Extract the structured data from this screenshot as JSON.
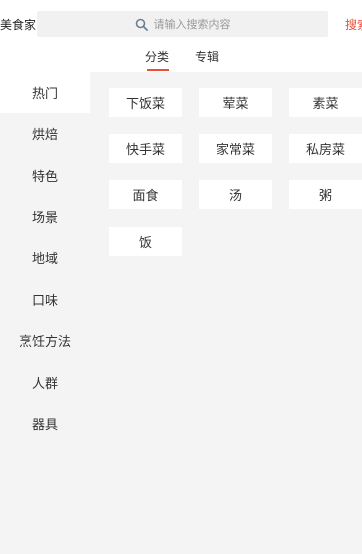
{
  "header": {
    "brand": "美食家",
    "search_placeholder": "请输入搜索内容",
    "search_button": "搜索"
  },
  "tabs": [
    {
      "label": "分类",
      "active": true
    },
    {
      "label": "专辑",
      "active": false
    }
  ],
  "sidebar": {
    "items": [
      {
        "label": "热门",
        "active": true
      },
      {
        "label": "烘焙"
      },
      {
        "label": "特色"
      },
      {
        "label": "场景"
      },
      {
        "label": "地域"
      },
      {
        "label": "口味"
      },
      {
        "label": "烹饪方法"
      },
      {
        "label": "人群"
      },
      {
        "label": "器具"
      }
    ]
  },
  "categories": [
    "下饭菜",
    "荤菜",
    "素菜",
    "快手菜",
    "家常菜",
    "私房菜",
    "面食",
    "汤",
    "粥",
    "饭"
  ],
  "colors": {
    "accent": "#e8503a",
    "sidebar_bg": "#f4f4f4",
    "chip_bg": "#ffffff"
  }
}
